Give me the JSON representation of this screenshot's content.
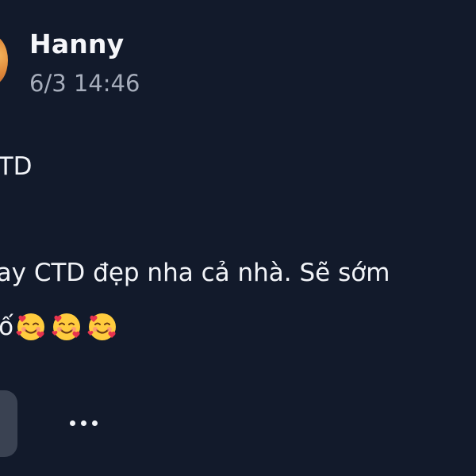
{
  "post": {
    "author": "Hanny",
    "timestamp": "6/3 14:46",
    "lines": [
      "CTD",
      "nay CTD đẹp nha cả nhà. Sẽ sớm",
      "số"
    ],
    "emojis": [
      "smiling-face-with-hearts",
      "smiling-face-with-hearts",
      "smiling-face-with-hearts"
    ]
  },
  "colors": {
    "background": "#121a2b",
    "text": "#f2f4f8",
    "muted": "#a6adbb",
    "button": "#3a4252"
  }
}
